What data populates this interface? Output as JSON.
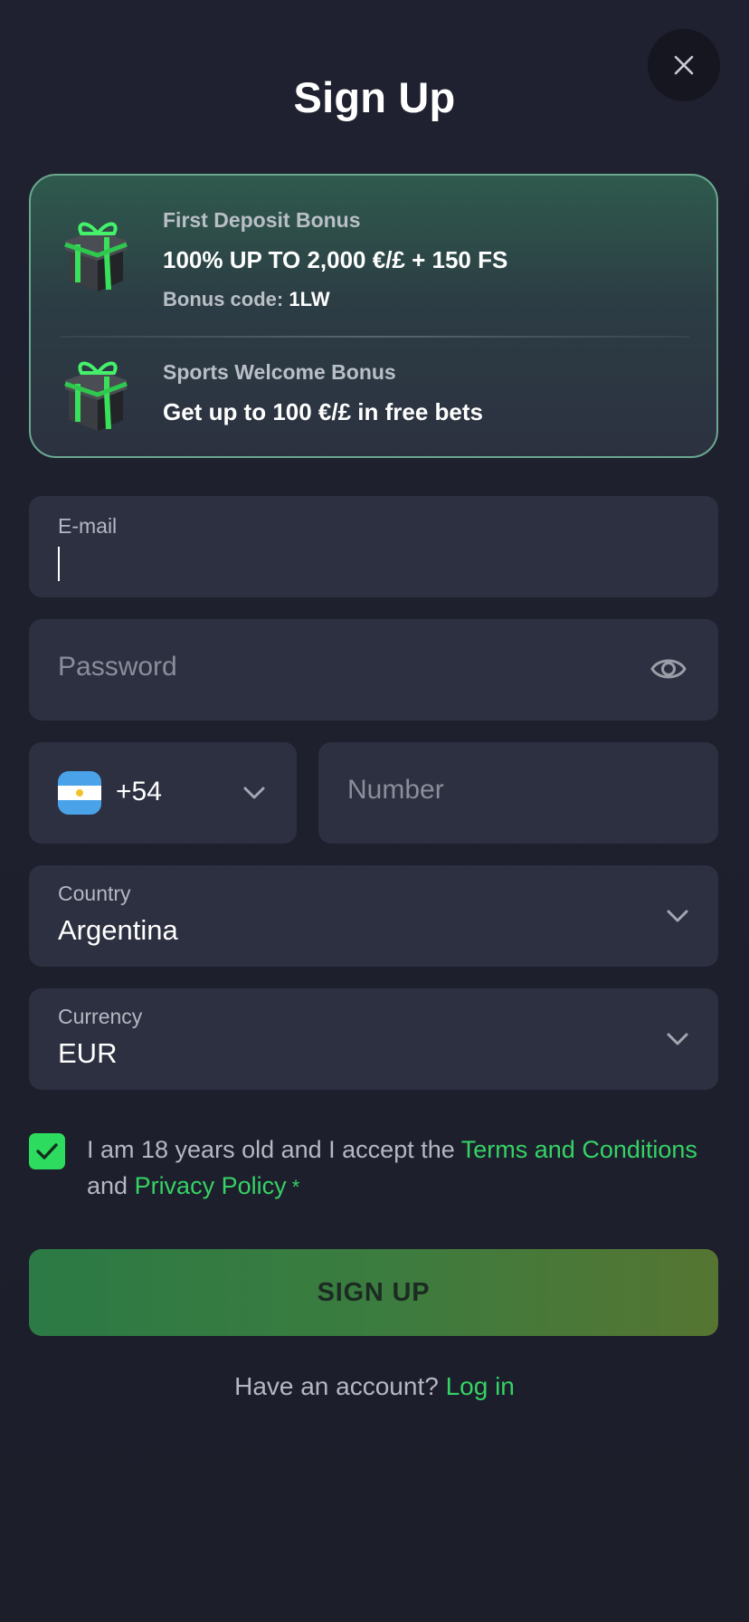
{
  "header": {
    "title": "Sign Up"
  },
  "bonuses": [
    {
      "label": "First Deposit Bonus",
      "headline": "100% UP TO 2,000 €/£ + 150 FS",
      "code_label": "Bonus code:",
      "code_value": "1LW"
    },
    {
      "label": "Sports Welcome Bonus",
      "headline": "Get up to 100 €/£ in free bets"
    }
  ],
  "form": {
    "email": {
      "label": "E-mail",
      "value": ""
    },
    "password": {
      "placeholder": "Password"
    },
    "phone": {
      "country_code": "+54",
      "flag": "argentina-flag-icon",
      "number_placeholder": "Number"
    },
    "country": {
      "label": "Country",
      "value": "Argentina"
    },
    "currency": {
      "label": "Currency",
      "value": "EUR"
    }
  },
  "consent": {
    "checked": true,
    "text_before": "I am 18 years old and I accept the ",
    "terms_link": "Terms and Conditions",
    "text_and": " and ",
    "privacy_link": "Privacy Policy",
    "required_mark": " *"
  },
  "actions": {
    "signup_label": "SIGN UP",
    "login_prompt": "Have an account? ",
    "login_link": "Log in"
  },
  "colors": {
    "background": "#1d1f2b",
    "field": "#2d3041",
    "accent_green": "#35d365",
    "checkbox": "#2ddc5e"
  }
}
